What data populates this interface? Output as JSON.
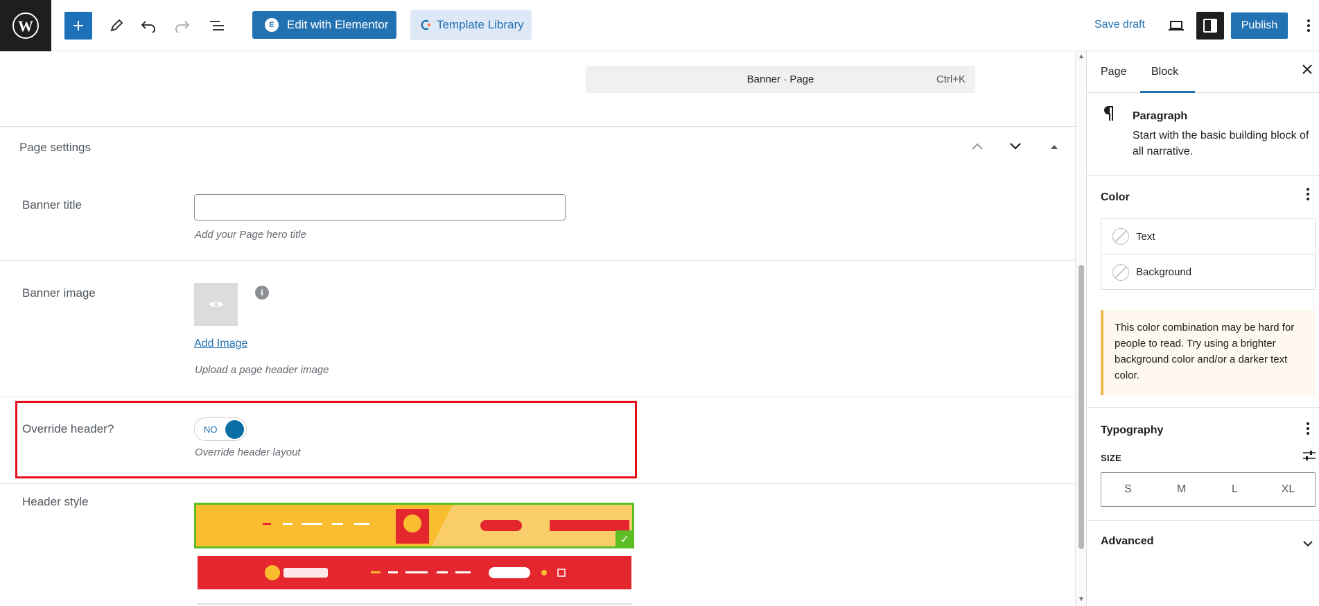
{
  "topbar": {
    "edit_elementor_label": "Edit with Elementor",
    "elementor_icon": "E",
    "template_library_label": "Template Library",
    "save_draft_label": "Save draft",
    "publish_label": "Publish"
  },
  "command_bar": {
    "title": "Banner · Page",
    "shortcut": "Ctrl+K"
  },
  "page_settings": {
    "title": "Page settings",
    "fields": {
      "banner_title": {
        "label": "Banner title",
        "value": "",
        "description": "Add your Page hero title"
      },
      "banner_image": {
        "label": "Banner image",
        "info": "i",
        "add_image_label": "Add Image",
        "description": "Upload a page header image"
      },
      "override_header": {
        "label": "Override header?",
        "toggle_label": "NO",
        "description": "Override header layout"
      },
      "header_style": {
        "label": "Header style",
        "options": [
          {
            "id": "style-1",
            "selected": true,
            "bg": "#fbbd30"
          },
          {
            "id": "style-2",
            "selected": false,
            "bg": "#e4262f"
          }
        ]
      }
    }
  },
  "sidebar": {
    "tabs": [
      "Page",
      "Block"
    ],
    "active_tab": "Block",
    "block": {
      "name": "Paragraph",
      "description": "Start with the basic building block of all narrative."
    },
    "color": {
      "title": "Color",
      "items": [
        "Text",
        "Background"
      ]
    },
    "notice": "This color combination may be hard for people to read. Try using a brighter background color and/or a darker text color.",
    "typography": {
      "title": "Typography",
      "size_label": "SIZE",
      "sizes": [
        "S",
        "M",
        "L",
        "XL"
      ]
    },
    "advanced": {
      "title": "Advanced"
    }
  },
  "colors": {
    "accent": "#2271b1",
    "highlight": "#e3101a",
    "selected_border": "#5cbd24"
  }
}
